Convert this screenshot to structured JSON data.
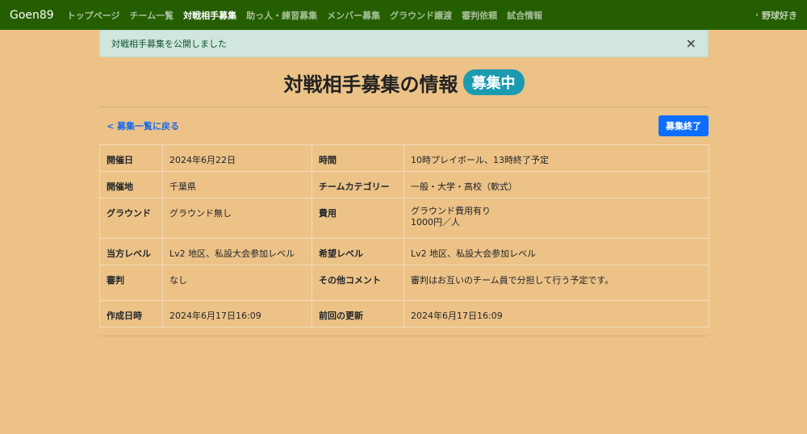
{
  "navbar": {
    "brand": "Goen89",
    "links": [
      "トップページ",
      "チーム一覧",
      "対戦相手募集",
      "助っ人・練習募集",
      "メンバー募集",
      "グラウンド譲渡",
      "審判依頼",
      "試合情報"
    ],
    "user": "野球好き"
  },
  "alert": {
    "message": "対戦相手募集を公開しました",
    "close": "×"
  },
  "page": {
    "title": "対戦相手募集の情報",
    "status_badge": "募集中"
  },
  "actions": {
    "back_link": "< 募集一覧に戻る",
    "close_button": "募集終了"
  },
  "details": {
    "date_label": "開催日",
    "date_value": "2024年6月22日",
    "time_label": "時間",
    "time_value": "10時プレイボール、13時終了予定",
    "place_label": "開催地",
    "place_value": "千葉県",
    "category_label": "チームカテゴリー",
    "category_value": "一般・大学・高校（軟式）",
    "ground_label": "グラウンド",
    "ground_value": "グラウンド無し",
    "fee_label": "費用",
    "fee_value_1": "グラウンド費用有り",
    "fee_value_2": "1000円／人",
    "our_level_label": "当方レベル",
    "our_level_value": "Lv2 地区、私設大会参加レベル",
    "wanted_level_label": "希望レベル",
    "wanted_level_value": "Lv2 地区、私設大会参加レベル",
    "umpire_label": "審判",
    "umpire_value": "なし",
    "comment_label": "その他コメント",
    "comment_value": "審判はお互いのチーム員で分担して行う予定です。",
    "created_label": "作成日時",
    "created_value": "2024年6月17日16:09",
    "updated_label": "前回の更新",
    "updated_value": "2024年6月17日16:09"
  }
}
